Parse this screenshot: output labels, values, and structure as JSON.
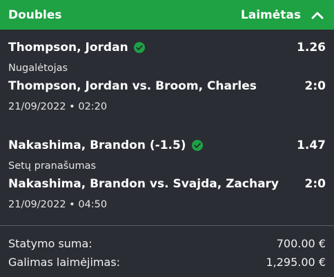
{
  "header": {
    "title": "Doubles",
    "status": "Laimėtas",
    "accent": "#1ea244"
  },
  "selections": [
    {
      "player": "Thompson, Jordan",
      "odds": "1.26",
      "market": "Nugalėtojas",
      "match": "Thompson, Jordan vs. Broom, Charles",
      "score": "2:0",
      "datetime": "21/09/2022 • 02:20",
      "status_icon": "check-circle-icon"
    },
    {
      "player": "Nakashima, Brandon (-1.5)",
      "odds": "1.47",
      "market": "Setų pranašumas",
      "match": "Nakashima, Brandon vs. Svajda, Zachary",
      "score": "2:0",
      "datetime": "21/09/2022 • 04:50",
      "status_icon": "check-circle-icon"
    }
  ],
  "summary": {
    "stake_label": "Statymo suma:",
    "stake_value": "700.00 €",
    "payout_label": "Galimas laimėjimas:",
    "payout_value": "1,295.00 €"
  }
}
